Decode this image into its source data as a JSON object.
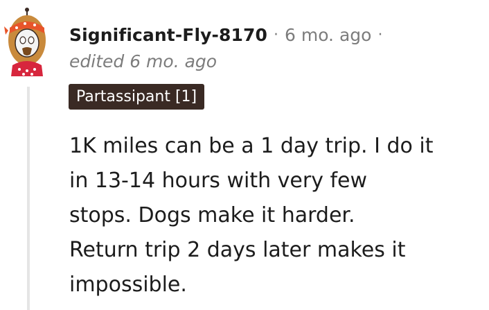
{
  "comment": {
    "author": "Significant-Fly-8170",
    "separator": "·",
    "timestamp": "6 mo. ago",
    "edited_label": "edited 6 mo. ago",
    "flair": "Partassipant [1]",
    "body_lines": [
      "1K miles can be a 1 day trip. I do it",
      "in 13-14 hours with very few",
      "stops. Dogs make it harder.",
      "Return trip 2 days later makes it",
      "impossible."
    ]
  },
  "avatar": {
    "icon": "user-avatar-icon",
    "colors": {
      "hair": "#c98a3c",
      "bandana": "#e8552a",
      "shirt": "#d7263d",
      "skin": "#f4f4f4"
    }
  },
  "colors": {
    "text": "#1c1c1c",
    "meta": "#7c7c7c",
    "flair_bg": "#3a2a24",
    "flair_text": "#ffffff",
    "thread_line": "#e5e5e5"
  }
}
